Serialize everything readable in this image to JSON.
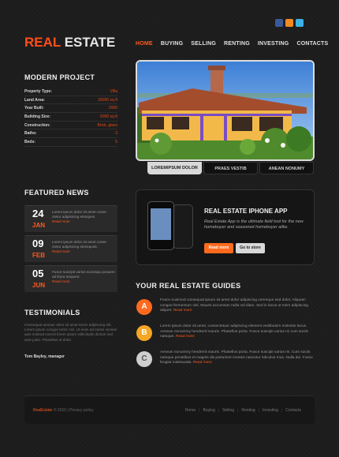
{
  "logo": {
    "part1": "REAL",
    "part2": "ESTATE"
  },
  "social": [
    "facebook-icon",
    "rss-icon",
    "twitter-icon"
  ],
  "nav": [
    "HOME",
    "BUYING",
    "SELLING",
    "RENTING",
    "INVESTING",
    "CONTACTS"
  ],
  "modern_project": {
    "title": "MODERN PROJECT",
    "rows": [
      {
        "k": "Property Type:",
        "v": "Villa"
      },
      {
        "k": "Land Area:",
        "v": "26000 sq.ft"
      },
      {
        "k": "Year Built:",
        "v": "2006"
      },
      {
        "k": "Building Size:",
        "v": "5000 sq.ft"
      },
      {
        "k": "Construction:",
        "v": "Brick, glass"
      },
      {
        "k": "Baths:",
        "v": "3"
      },
      {
        "k": "Beds:",
        "v": "5"
      }
    ]
  },
  "tabs": [
    "LOREMIPSUM DOLOR",
    "PRAES VESTIB",
    "ANEAN NONUMY"
  ],
  "featured_news": {
    "title": "FEATURED NEWS",
    "items": [
      {
        "day": "24",
        "month": "JAN",
        "text": "Lorem ipsum dolor sit amet conse ctetur adipisicing elenques.",
        "more": "Read more"
      },
      {
        "day": "09",
        "month": "FEB",
        "text": "Lorem ipsum dolor sit amet conse ctetur adipisicing elenequeit.",
        "more": "Read more"
      },
      {
        "day": "05",
        "month": "JUN",
        "text": "Fusce suscipit varius sociosqu posuere ad litora torquent.",
        "more": "Read more"
      }
    ]
  },
  "testimonials": {
    "title": "TESTIMONIALS",
    "text": "Consequat aenean dolor sit amet lorem adipiscing elit. Lorem ipsum congue tortor nisl. Ut enim ad minim veniam quis nostrud exercit lorem ipsum sollicitudin dictum sed ante justo. Phasellus ut dolor.",
    "author": "Tom Bayley, manager"
  },
  "app": {
    "title": "REAL ESTATE IPHONE APP",
    "text": "Real Estate App is the ultimate field tool for the new homebuyer and seasoned homebuyer alike.",
    "btn_more": "Read more",
    "btn_store": "Go to store"
  },
  "guides": {
    "title": "YOUR REAL ESTATE GUIDES",
    "items": [
      {
        "letter": "A",
        "color": "#ff6a1f",
        "text": "Fusce euismod consequat ipsum sit amet dolor adipiscing cerenque sed dolor. Aliquam congue fermentum nisl. Mauris accumsan nulla vel diam. Sed in lacus ut enim adipiscing aliquet.",
        "more": "Read more"
      },
      {
        "letter": "B",
        "color": "#f5a623",
        "text": "Lorem ipsum dolor sit amet, consectetuer adipiscing element vestibulum molestie lacus. Aenean nonummy hendrerit mauris. Phasellus porta. Fusce suscipit varius mi cum sociis natoque.",
        "more": "Read more"
      },
      {
        "letter": "C",
        "color": "#cfcfcf",
        "text": "Aenean nonummy hendrerit mauris. Phasellus porta. Fusce suscipit varius mi. Cum sociis natoque penatibus et magnis dis parturient montes nascetur ridiculus mus. Nulla dui. Fusce feugiat malesuada.",
        "more": "Read more"
      }
    ]
  },
  "footer": {
    "brand": "RealEstate",
    "copy": "© 2010 | Privacy policy",
    "links": [
      "Home",
      "Buying",
      "Selling",
      "Renting",
      "Investing",
      "Contacts"
    ]
  }
}
